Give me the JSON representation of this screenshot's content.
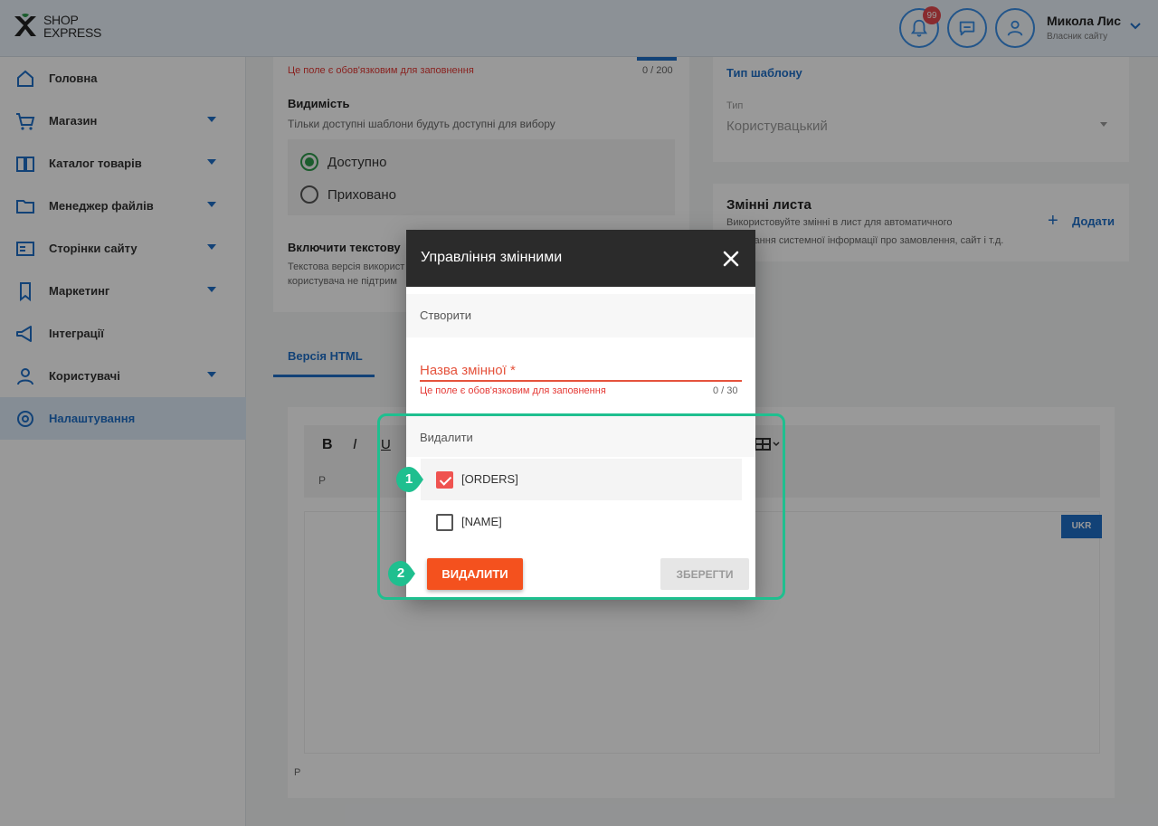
{
  "brand": {
    "line1": "SHOP",
    "line2": "EXPRESS"
  },
  "header": {
    "notifications_count": "99",
    "user_name": "Микола Лис",
    "user_role": "Власник сайту"
  },
  "sidebar": {
    "items": [
      {
        "label": "Головна",
        "icon": "home-icon",
        "has_caret": false
      },
      {
        "label": "Магазин",
        "icon": "cart-icon",
        "has_caret": true
      },
      {
        "label": "Каталог товарів",
        "icon": "book-icon",
        "has_caret": true
      },
      {
        "label": "Менеджер файлів",
        "icon": "folder-icon",
        "has_caret": true
      },
      {
        "label": "Сторінки сайту",
        "icon": "pages-icon",
        "has_caret": true
      },
      {
        "label": "Маркетинг",
        "icon": "tag-icon",
        "has_caret": true
      },
      {
        "label": "Інтеграції",
        "icon": "megaphone-icon",
        "has_caret": false
      },
      {
        "label": "Користувачі",
        "icon": "users-icon",
        "has_caret": true
      },
      {
        "label": "Налаштування",
        "icon": "gear-icon",
        "has_caret": false,
        "active": true
      }
    ]
  },
  "background": {
    "required_error": "Це поле є обов'язковим для заповнення",
    "name_count": "0 / 200",
    "visibility_title": "Видимість",
    "visibility_hint": "Тільки доступні шаблони будуть доступні для вибору",
    "radio_available": "Доступно",
    "radio_hidden": "Приховано",
    "text_version_title": "Включити текстову",
    "text_version_hint1": "Текстова версія використ",
    "text_version_hint2": "користувача не підтрим",
    "tab_html": "Версія HTML",
    "template_type_title": "Тип шаблону",
    "type_label": "Тип",
    "type_value": "Користувацький",
    "vars_title": "Змінні листа",
    "vars_hint1": "Використовуйте змінні в лист для автоматичного",
    "vars_hint2": "додавання системної інформації про замовлення, сайт і т.д.",
    "add_label": "Додати",
    "editor_paragraph": "P",
    "lang_badge": "UKR"
  },
  "modal": {
    "title": "Управління змінними",
    "create_section": "Створити",
    "field_label": "Назва змінної *",
    "field_help": "Це поле є обов'язковим для заповнення",
    "field_count": "0 / 30",
    "delete_section": "Видалити",
    "variables": [
      {
        "label": "[ORDERS]",
        "checked": true
      },
      {
        "label": "[NAME]",
        "checked": false
      }
    ],
    "delete_button": "ВИДАЛИТИ",
    "save_button": "ЗБЕРЕГТИ"
  },
  "annotations": {
    "step1": "1",
    "step2": "2"
  },
  "colors": {
    "accent": "#1f6fc7",
    "annotation": "#1fbf8f",
    "danger": "#f4511e"
  }
}
